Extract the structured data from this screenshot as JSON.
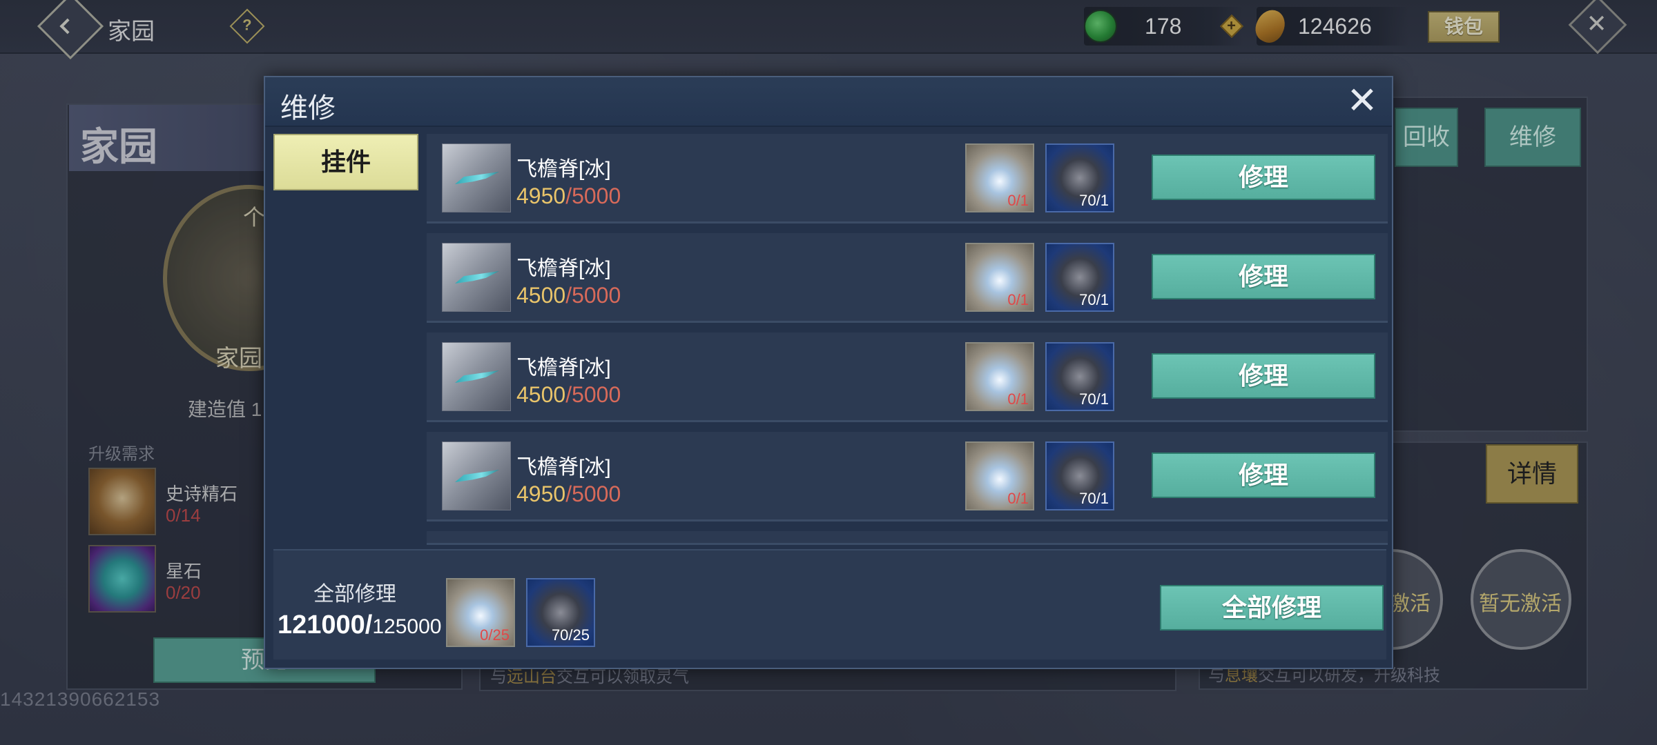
{
  "topbar": {
    "title": "家园",
    "jade_amount": "178",
    "coin_amount": "124626",
    "wallet_label": "钱包",
    "help_glyph": "?",
    "close_glyph": "✕"
  },
  "background": {
    "left_title": "家园",
    "emblem_top": "个",
    "emblem_bottom": "家园",
    "build_value": "建造值 1",
    "upgrade_label": "升级需求",
    "materials": [
      {
        "name": "史诗精石",
        "count": "0/14",
        "icon": "epic-stone-icon"
      },
      {
        "name": "星石",
        "count": "0/20",
        "icon": "star-stone-icon"
      }
    ],
    "preview_label": "预览",
    "recycle_label": "回收",
    "repair_tab_label": "维修",
    "detail_label": "详情",
    "seal_1": "激活",
    "seal_2": "暂无激活",
    "hint_mid_prefix": "与",
    "hint_mid_place": "远山台",
    "hint_mid_suffix": "交互可以领取灵气",
    "hint_right_prefix": "与",
    "hint_right_place": "息壤",
    "hint_right_suffix": "交互可以研发，升级科技",
    "uid": "14321390662153"
  },
  "modal": {
    "title": "维修",
    "close_glyph": "✕",
    "category_tab": "挂件",
    "items": [
      {
        "name": "飞檐脊[冰]",
        "dur_cur": "4950",
        "dur_max": "/5000",
        "flame_req": "0/1",
        "ore_req": "70/1",
        "button": "修理"
      },
      {
        "name": "飞檐脊[冰]",
        "dur_cur": "4500",
        "dur_max": "/5000",
        "flame_req": "0/1",
        "ore_req": "70/1",
        "button": "修理"
      },
      {
        "name": "飞檐脊[冰]",
        "dur_cur": "4500",
        "dur_max": "/5000",
        "flame_req": "0/1",
        "ore_req": "70/1",
        "button": "修理"
      },
      {
        "name": "飞檐脊[冰]",
        "dur_cur": "4950",
        "dur_max": "/5000",
        "flame_req": "0/1",
        "ore_req": "70/1",
        "button": "修理"
      }
    ],
    "footer": {
      "label": "全部修理",
      "dur_cur": "121000/",
      "dur_max": "125000",
      "flame_req": "0/25",
      "ore_req": "70/25",
      "button": "全部修理"
    }
  },
  "colors": {
    "accent_teal": "#5fb8a8",
    "gold": "#e9c46a",
    "red": "#d86a5a"
  }
}
